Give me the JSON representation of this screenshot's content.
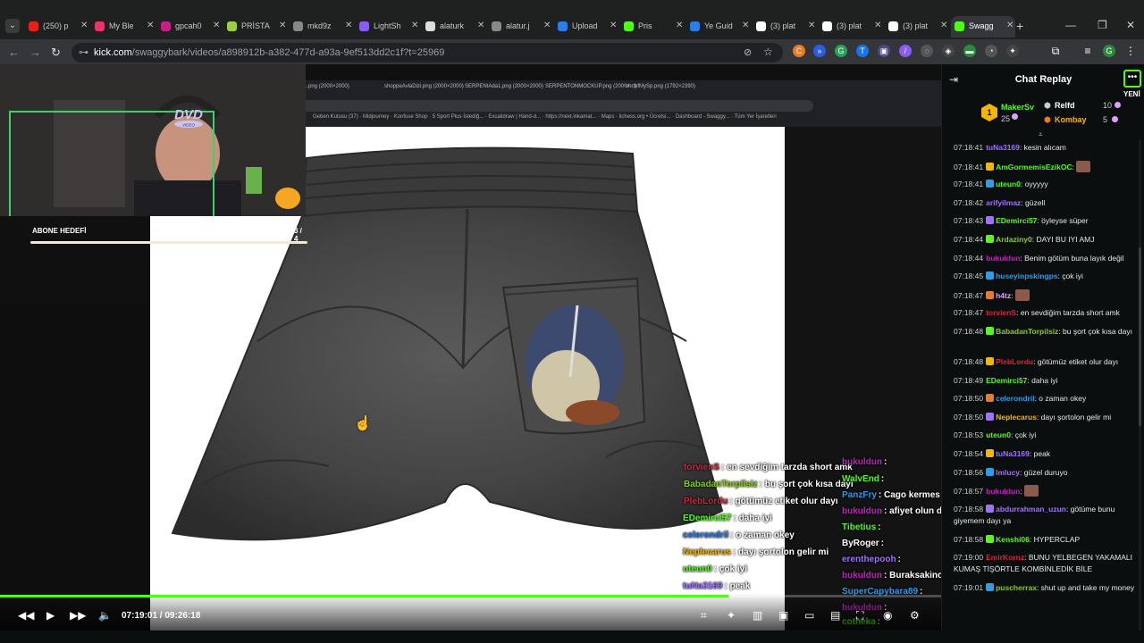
{
  "browser": {
    "tabs": [
      {
        "label": "(250) p",
        "color": "#e62117"
      },
      {
        "label": "My Ble",
        "color": "#e8346b"
      },
      {
        "label": "gpcah0",
        "color": "#c81e8a"
      },
      {
        "label": "PRİSTA",
        "color": "#9ad042"
      },
      {
        "label": "mkd9z",
        "color": "#888888"
      },
      {
        "label": "LightSh",
        "color": "#8a5cf6"
      },
      {
        "label": "alaturk",
        "color": "#dddddd"
      },
      {
        "label": "alatur.j",
        "color": "#888888"
      },
      {
        "label": "Upload",
        "color": "#2b7de9"
      },
      {
        "label": "Pris",
        "color": "#53fc18"
      },
      {
        "label": "Ye Guid",
        "color": "#2b7de9"
      },
      {
        "label": "(3) plat",
        "color": "#ffffff"
      },
      {
        "label": "(3) plat",
        "color": "#ffffff"
      },
      {
        "label": "(3) plat",
        "color": "#ffffff"
      },
      {
        "label": "Swagg",
        "color": "#53fc18"
      }
    ],
    "url_host": "kick.com",
    "url_path": "/swaggybark/videos/a898912b-a382-477d-a93a-9ef513dd2c1f?t=25969"
  },
  "stream": {
    "sub_goal_label": "ABONE HEDEFİ",
    "sub_goal_count": "3 / 4",
    "sub_goal_progress": 0.75,
    "dvd_text": "DVD",
    "dvd_sub": "VIDEO"
  },
  "inner_browser": {
    "tabs": [
      "...png (2000×2000)",
      "shoppeAvlaDizi.png (2000×2000)",
      "SERPENtAda1.png (2000×2000)",
      "SERPENTONMOCKUP.png (2000×...)",
      "shrtbfMySp.png (1792×2390)"
    ],
    "bookmarks": "Geben Kutusu (37) ·  Midjourney ·  Konfuse Shop ·  5 Sport Plus·İstediğ... ·  Excalidraw | Hand-d... ·  https://next.inkamat... ·  Maps ·  lichess.org • Ücretsi... ·  Dashboard - Swaggy... ·  Tüm Yer İşaretleri"
  },
  "overlay_chat": [
    {
      "user": "torvienS",
      "msg": ": en sevdiğim tarzda short amk",
      "color": "#e0203a"
    },
    {
      "user": "BabadanTorpilsiz",
      "msg": ": bu şort çok kısa dayı",
      "color": "#8ac926"
    },
    {
      "user": "PlebLordu",
      "msg": ": götümüz etiket olur dayı",
      "color": "#e0203a"
    },
    {
      "user": "EDemirci57",
      "msg": ": daha iyi",
      "color": "#53fc18"
    },
    {
      "user": "celerondril",
      "msg": ": o zaman okey",
      "color": "#2b7de9"
    },
    {
      "user": "Neplecarus",
      "msg": ": dayı şortolon gelir mi",
      "color": "#f2b705"
    },
    {
      "user": "uteun0",
      "msg": ": çok iyi",
      "color": "#53fc18"
    },
    {
      "user": "tuNa3169",
      "msg": ": peak",
      "color": "#a070ff"
    },
    {
      "user": "bukuldun",
      "msg": ":",
      "color": "#c71ec6"
    },
    {
      "user": "WalvEnd",
      "msg": ":",
      "color": "#53fc18"
    },
    {
      "user": "PanzFry",
      "msg": ": Cago kermes düzenledi",
      "color": "#2b9de9"
    },
    {
      "user": "bukuldun",
      "msg": ": afiyet olun dayı",
      "color": "#c71ec6"
    },
    {
      "user": "Tibetius",
      "msg": ":",
      "color": "#53fc18"
    },
    {
      "user": "ByRoger",
      "msg": ":",
      "color": "#ffffff"
    },
    {
      "user": "erenthepooh",
      "msg": ":",
      "color": "#a070ff"
    },
    {
      "user": "bukuldun",
      "msg": ": Buraksakinol niye mi yemekhanede",
      "color": "#c71ec6"
    },
    {
      "user": "SuperCapybara89",
      "msg": ":",
      "color": "#2b9de9"
    },
    {
      "user": "bukuldun",
      "msg": ":",
      "color": "#c71ec6"
    },
    {
      "user": "cotheka",
      "msg": ":",
      "color": "#53fc18"
    }
  ],
  "player": {
    "current_time": "07:19:01",
    "duration": "09:26:18",
    "time_display": "07:19:01 / 09:26:18",
    "progress": 0.774
  },
  "chat": {
    "title": "Chat Replay",
    "new_label": "YENİ",
    "pinned": {
      "first_user": "MakerSv",
      "first_count": "25",
      "first_rank": "1",
      "second_user": "Relfd",
      "second_count": "10",
      "third_user": "Kombay",
      "third_count": "5"
    },
    "messages": [
      {
        "time": "07:18:41",
        "user": "tuNa3169",
        "text": "kesin alıcam",
        "color": "#a070ff"
      },
      {
        "time": "07:18:41",
        "user": "AmGormemisEzikOC",
        "text": "",
        "color": "#53fc18"
      },
      {
        "time": "07:18:41",
        "user": "uteun0",
        "text": "oyyyyy",
        "color": "#53fc18"
      },
      {
        "time": "07:18:42",
        "user": "arifyilmaz",
        "text": "güzell",
        "color": "#a070ff"
      },
      {
        "time": "07:18:43",
        "user": "EDemirci57",
        "text": "öyleyse süper",
        "color": "#53fc18"
      },
      {
        "time": "07:18:44",
        "user": "Ardaziny0",
        "text": "DAYI BU IYI AMJ",
        "color": "#8ac926"
      },
      {
        "time": "07:18:44",
        "user": "bukuldun",
        "text": "Benim götüm buna layık değil",
        "color": "#c71ec6"
      },
      {
        "time": "07:18:45",
        "user": "huseyinpskingps",
        "text": "çok iyi",
        "color": "#2b9de9"
      },
      {
        "time": "07:18:47",
        "user": "h4tz",
        "text": "",
        "color": "#e0a0ff"
      },
      {
        "time": "07:18:47",
        "user": "torvienS",
        "text": "en sevdiğim tarzda short amk",
        "color": "#e0203a"
      },
      {
        "time": "07:18:48",
        "user": "BabadanTorpilsiz",
        "text": "bu şort çok kısa dayı",
        "color": "#8ac926"
      },
      {
        "time": "07:18:48",
        "user": "PlebLordu",
        "text": "götümüz etiket olur dayı",
        "color": "#e0203a"
      },
      {
        "time": "07:18:49",
        "user": "EDemirci57",
        "text": "daha iyi",
        "color": "#53fc18"
      },
      {
        "time": "07:18:50",
        "user": "celerondril",
        "text": "o zaman okey",
        "color": "#2b9de9"
      },
      {
        "time": "07:18:50",
        "user": "Neplecarus",
        "text": "dayı şortolon gelir mi",
        "color": "#f2b705"
      },
      {
        "time": "07:18:53",
        "user": "uteun0",
        "text": "çok iyi",
        "color": "#53fc18"
      },
      {
        "time": "07:18:54",
        "user": "tuNa3169",
        "text": "peak",
        "color": "#a070ff"
      },
      {
        "time": "07:18:56",
        "user": "lmlucy",
        "text": "güzel duruyo",
        "color": "#a070ff"
      },
      {
        "time": "07:18:57",
        "user": "bukuldun",
        "text": "",
        "color": "#c71ec6"
      },
      {
        "time": "07:18:58",
        "user": "abdurrahman_uzun",
        "text": "götüme bunu giyemem dayı ya",
        "color": "#a070ff"
      },
      {
        "time": "07:18:58",
        "user": "Kenshi06",
        "text": "HYPERCLAP",
        "color": "#53fc18"
      },
      {
        "time": "07:19:00",
        "user": "EmirKornz",
        "text": "BUNU YELBEGEN YAKAMALI KUMAŞ TİŞÖRTLE KOMBİNLEDİK BİLE",
        "color": "#e0203a"
      },
      {
        "time": "07:19:01",
        "user": "puscherrax",
        "text": "shut up and take my money",
        "color": "#8ac926"
      }
    ]
  }
}
